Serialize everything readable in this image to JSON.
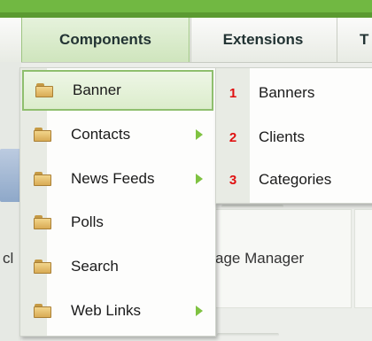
{
  "menubar": {
    "tabs": [
      {
        "label": "Components"
      },
      {
        "label": "Extensions"
      },
      {
        "label": "T"
      }
    ]
  },
  "background": {
    "partial_text_left": "cl",
    "partial_text_right": "age Manager"
  },
  "dropdown": {
    "items": [
      {
        "label": "Banner",
        "icon": "folder-icon",
        "has_submenu": false,
        "highlighted": true
      },
      {
        "label": "Contacts",
        "icon": "folder-icon",
        "has_submenu": true
      },
      {
        "label": "News Feeds",
        "icon": "folder-icon",
        "has_submenu": true
      },
      {
        "label": "Polls",
        "icon": "folder-icon",
        "has_submenu": false
      },
      {
        "label": "Search",
        "icon": "folder-icon",
        "has_submenu": false
      },
      {
        "label": "Web Links",
        "icon": "folder-icon",
        "has_submenu": true
      }
    ]
  },
  "submenu": {
    "items": [
      {
        "number": "1",
        "label": "Banners"
      },
      {
        "number": "2",
        "label": "Clients"
      },
      {
        "number": "3",
        "label": "Categories"
      }
    ]
  },
  "colors": {
    "accent_green": "#71b842",
    "annotation_red": "#e01010",
    "arrow_green": "#7fc241"
  }
}
